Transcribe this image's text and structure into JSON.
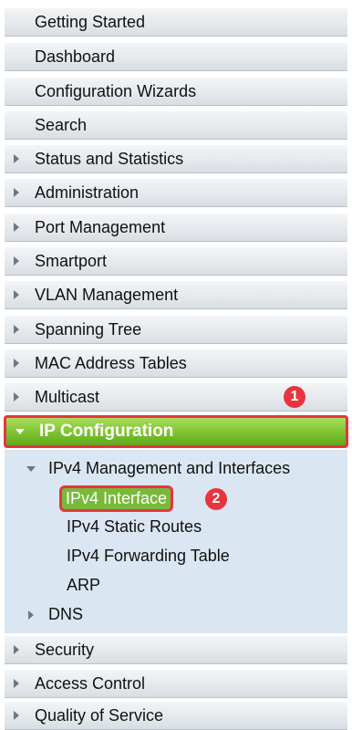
{
  "menu": {
    "getting_started": "Getting Started",
    "dashboard": "Dashboard",
    "configuration_wizards": "Configuration Wizards",
    "search": "Search",
    "status_and_statistics": "Status and Statistics",
    "administration": "Administration",
    "port_management": "Port Management",
    "smartport": "Smartport",
    "vlan_management": "VLAN Management",
    "spanning_tree": "Spanning Tree",
    "mac_address_tables": "MAC Address Tables",
    "multicast": "Multicast",
    "ip_configuration": "IP Configuration",
    "security": "Security",
    "access_control": "Access Control",
    "quality_of_service": "Quality of Service"
  },
  "submenu": {
    "ipv4_mgmt": "IPv4 Management and Interfaces",
    "ipv4_interface": "IPv4 Interface",
    "ipv4_static_routes": "IPv4 Static Routes",
    "ipv4_forwarding_table": "IPv4 Forwarding Table",
    "arp": "ARP",
    "dns": "DNS"
  },
  "annotations": {
    "step1": "1",
    "step2": "2"
  },
  "colors": {
    "active_green": "#7cc22f",
    "highlight_red": "#e8343f",
    "submenu_bg": "#dae6f1"
  }
}
